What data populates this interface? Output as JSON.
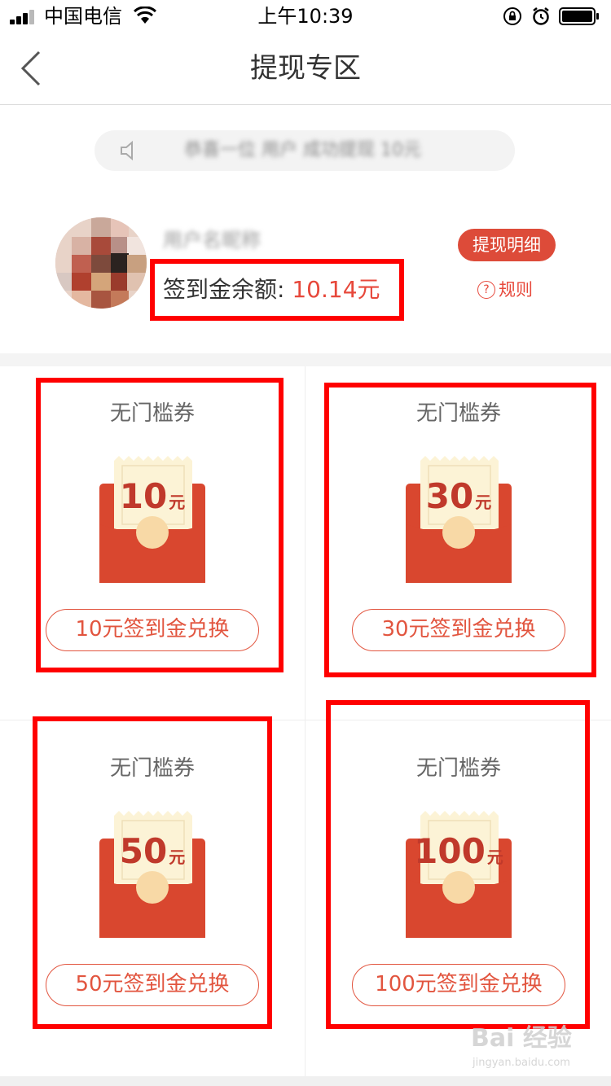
{
  "status_bar": {
    "carrier": "中国电信",
    "time": "上午10:39"
  },
  "nav": {
    "title": "提现专区"
  },
  "notice": {
    "text": "恭喜一位 用户 成功提现 10元"
  },
  "user": {
    "name": "用户名昵称",
    "balance_label": "签到金余额: ",
    "balance_value": "10.14元",
    "detail_button": "提现明细",
    "rules_label": "规则"
  },
  "coupons": [
    {
      "title": "无门槛券",
      "amount": "10",
      "unit": "元",
      "button": "10元签到金兑换"
    },
    {
      "title": "无门槛券",
      "amount": "30",
      "unit": "元",
      "button": "30元签到金兑换"
    },
    {
      "title": "无门槛券",
      "amount": "50",
      "unit": "元",
      "button": "50元签到金兑换"
    },
    {
      "title": "无门槛券",
      "amount": "100",
      "unit": "元",
      "button": "100元签到金兑换"
    }
  ],
  "watermark": {
    "main": "Bai 经验",
    "sub": "jingyan.baidu.com"
  },
  "colors": {
    "accent_red": "#e7483b",
    "envelope_red": "#d9472f",
    "ticket_cream": "#fcf3d6",
    "highlight_box": "#ff0000"
  },
  "icons": [
    "signal-icon",
    "wifi-icon",
    "orientation-lock-icon",
    "alarm-icon",
    "battery-icon",
    "back-arrow-icon",
    "speaker-icon",
    "question-icon",
    "red-envelope-icon"
  ]
}
